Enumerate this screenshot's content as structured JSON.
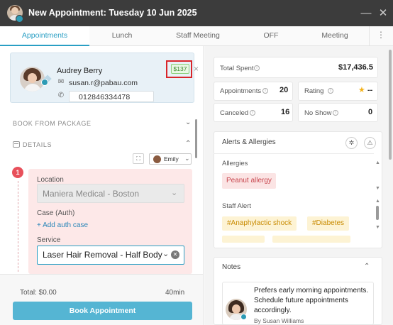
{
  "window": {
    "title": "New Appointment: Tuesday 10 Jun 2025",
    "minimize_glyph": "—",
    "close_glyph": "✕"
  },
  "tabs": [
    {
      "label": "Appointments",
      "active": true
    },
    {
      "label": "Lunch",
      "active": false
    },
    {
      "label": "Staff Meeting",
      "active": false
    },
    {
      "label": "OFF",
      "active": false
    },
    {
      "label": "Meeting",
      "active": false
    }
  ],
  "tabs_more": "⋮",
  "client": {
    "name": "Audrey Berry",
    "email": "susan.r@pabau.com",
    "phone": "012846334478",
    "total_spent_chip": "$137"
  },
  "left": {
    "book_from_package": "BOOK FROM PACKAGE",
    "details": "DETAILS",
    "staff_selected": "Emily",
    "step_number": "1",
    "location_label": "Location",
    "location_value": "Maniera Medical - Boston",
    "case_label": "Case (Auth)",
    "add_auth_case": "+ Add auth case",
    "service_label": "Service",
    "service_value": "Laser Hair Removal - Half Body",
    "total": "Total: $0.00",
    "duration": "40min",
    "book_button": "Book Appointment"
  },
  "stats": {
    "total_spent_label": "Total Spent",
    "total_spent_value": "$17,436.5",
    "appointments_label": "Appointments",
    "appointments_value": "20",
    "rating_label": "Rating",
    "rating_value": "--",
    "canceled_label": "Canceled",
    "canceled_value": "16",
    "no_show_label": "No Show",
    "no_show_value": "0"
  },
  "alerts": {
    "title": "Alerts & Allergies",
    "allergies_label": "Allergies",
    "allergies": [
      "Peanut allergy"
    ],
    "staff_alert_label": "Staff Alert",
    "staff_alerts": [
      "#Anaphylactic shock",
      "#Diabetes"
    ]
  },
  "notes": {
    "title": "Notes",
    "note_lines": [
      "Prefers early morning appointments.",
      "Schedule future appointments",
      "accordingly."
    ],
    "author": "By Susan Williams"
  },
  "colors": {
    "accent": "#2a9fc4",
    "button": "#55b5d3",
    "highlight_border": "#d9252a",
    "allergy_text": "#c8474f",
    "alert_text": "#c88a00"
  }
}
